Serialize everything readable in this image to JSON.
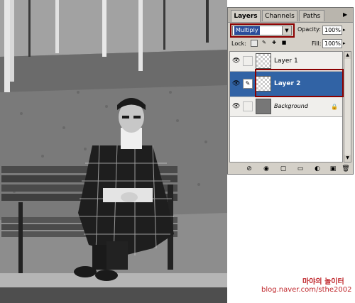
{
  "tabs": {
    "layers": "Layers",
    "channels": "Channels",
    "paths": "Paths",
    "menu_icon": "panel-menu-icon"
  },
  "blend": {
    "mode": "Multiply",
    "arrow": "▼"
  },
  "opacity": {
    "label": "Opacity:",
    "value": "100%",
    "arrow": "▸"
  },
  "lock": {
    "label": "Lock:",
    "icons": [
      "lock-transparent-icon",
      "lock-image-icon",
      "lock-position-icon",
      "lock-all-icon"
    ]
  },
  "fill": {
    "label": "Fill:",
    "value": "100%",
    "arrow": "▸"
  },
  "layers": [
    {
      "name": "Layer 1",
      "selected": false,
      "visible": true
    },
    {
      "name": "Layer 2",
      "selected": true,
      "visible": true
    },
    {
      "name": "Background",
      "selected": false,
      "visible": true,
      "locked": true
    }
  ],
  "watermark": {
    "line1": "마야의 놀이터",
    "line2": "blog.naver.com/sthe2002"
  },
  "colors": {
    "selection": "#3163a5",
    "highlight": "#8b0000",
    "watermark": "#c0282d"
  }
}
